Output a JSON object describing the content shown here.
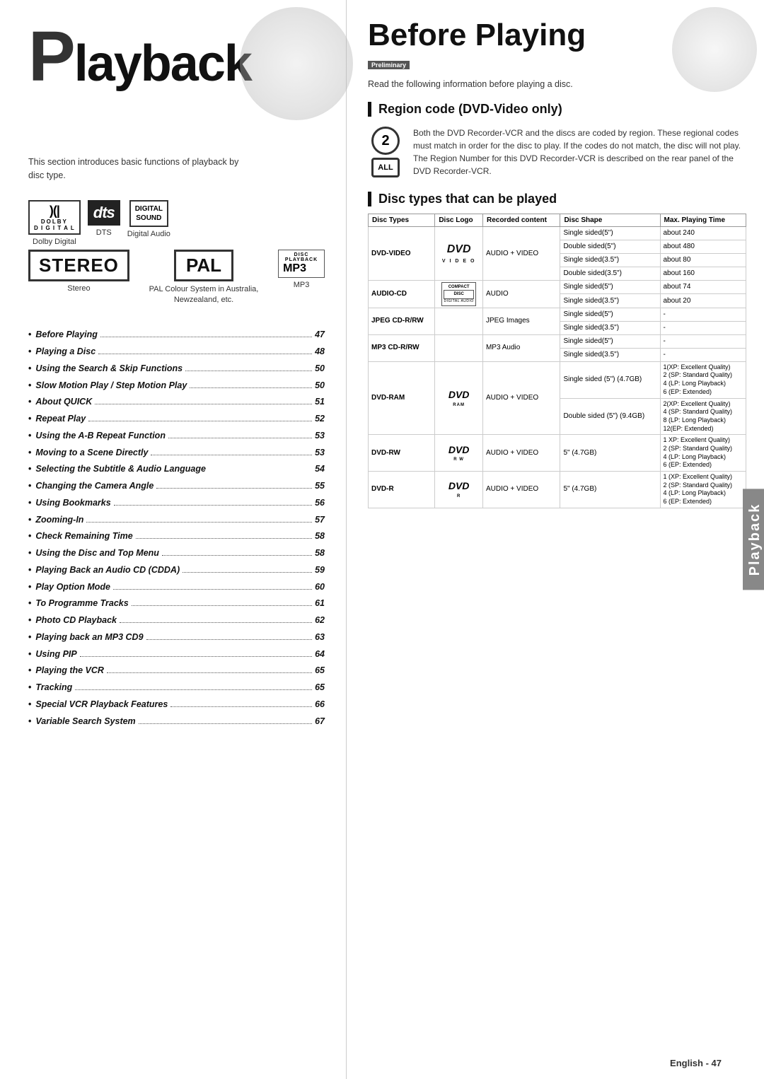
{
  "left": {
    "title_prefix": "P",
    "title_rest": "layback",
    "intro": "This section introduces basic functions of playback by disc type.",
    "logos": {
      "dolby_symbol": ")(|",
      "dolby_label": "DOLBY",
      "dolby_digital": "D I G I T A L",
      "dolby_caption": "Dolby Digital",
      "dts_text": "dts",
      "dts_caption": "DTS",
      "digital_sound_line1": "DIGITAL",
      "digital_sound_line2": "SOUND",
      "digital_caption": "Digital Audio",
      "stereo_text": "STEREO",
      "pal_text": "PAL",
      "pal_caption": "PAL Colour System in Australia, Newzealand, etc.",
      "stereo_caption": "Stereo",
      "mp3_text": "MP3",
      "mp3_caption": "MP3"
    },
    "toc": [
      {
        "label": "Before Playing",
        "dots": true,
        "page": "47"
      },
      {
        "label": "Playing a Disc",
        "dots": true,
        "page": "48"
      },
      {
        "label": "Using the Search & Skip Functions",
        "dots": true,
        "page": "50"
      },
      {
        "label": "Slow Motion Play / Step Motion Play",
        "dots": true,
        "page": "50"
      },
      {
        "label": "About QUICK",
        "dots": true,
        "page": "51"
      },
      {
        "label": "Repeat Play",
        "dots": true,
        "page": "52"
      },
      {
        "label": "Using the A-B Repeat Function",
        "dots": true,
        "page": "53"
      },
      {
        "label": "Moving to a Scene Directly",
        "dots": true,
        "page": "53"
      },
      {
        "label": "Selecting the Subtitle & Audio Language",
        "dots": false,
        "page": "54"
      },
      {
        "label": "Changing the Camera Angle",
        "dots": true,
        "page": "55"
      },
      {
        "label": "Using Bookmarks",
        "dots": true,
        "page": "56"
      },
      {
        "label": "Zooming-In",
        "dots": true,
        "page": "57"
      },
      {
        "label": "Check Remaining Time",
        "dots": true,
        "page": "58"
      },
      {
        "label": "Using the Disc and Top Menu",
        "dots": true,
        "page": "58"
      },
      {
        "label": "Playing Back an Audio CD (CDDA)",
        "dots": true,
        "page": "59"
      },
      {
        "label": "Play Option Mode",
        "dots": true,
        "page": "60"
      },
      {
        "label": "To Programme Tracks",
        "dots": true,
        "page": "61"
      },
      {
        "label": "Photo CD Playback",
        "dots": true,
        "page": "62"
      },
      {
        "label": "Playing back an MP3 CD9",
        "dots": true,
        "page": "63"
      },
      {
        "label": "Using PIP",
        "dots": true,
        "page": "64"
      },
      {
        "label": "Playing the VCR",
        "dots": true,
        "page": "65"
      },
      {
        "label": "Tracking",
        "dots": true,
        "page": "65"
      },
      {
        "label": "Special VCR Playback Features",
        "dots": true,
        "page": "66"
      },
      {
        "label": "Variable Search System",
        "dots": true,
        "page": "67"
      }
    ]
  },
  "right": {
    "title": "Before Playing",
    "preliminary_badge": "Preliminary",
    "read_intro": "Read the following information before playing a disc.",
    "region_title": "Region code (DVD-Video only)",
    "region_num": "2",
    "region_all": "ALL",
    "region_text": "Both the DVD Recorder-VCR and the discs are coded by region. These regional codes must match in order for the disc to play. If the codes do not match, the disc will not play. The Region Number for this DVD Recorder-VCR is described on the rear panel of the DVD Recorder-VCR.",
    "disc_title": "Disc types that can be played",
    "table": {
      "headers": [
        "Disc Types",
        "Disc Logo",
        "Recorded content",
        "Disc Shape",
        "Max. Playing Time"
      ],
      "rows": [
        {
          "type": "DVD-VIDEO",
          "logo": "DVD VIDEO",
          "content": "AUDIO + VIDEO",
          "shapes": [
            {
              "shape": "Single sided(5\")",
              "time": "about 240"
            },
            {
              "shape": "Double sided(5\")",
              "time": "about 480"
            },
            {
              "shape": "Single sided(3.5\")",
              "time": "about 80"
            },
            {
              "shape": "Double sided(3.5\")",
              "time": "about 160"
            }
          ]
        },
        {
          "type": "AUDIO-CD",
          "logo": "COMPACT DISC DIGITAL AUDIO",
          "content": "AUDIO",
          "shapes": [
            {
              "shape": "Single sided(5\")",
              "time": "about 74"
            },
            {
              "shape": "Single sided(3.5\")",
              "time": "about 20"
            }
          ]
        },
        {
          "type": "JPEG CD-R/RW",
          "logo": "",
          "content": "JPEG Images",
          "shapes": [
            {
              "shape": "Single sided(5\")",
              "time": "-"
            },
            {
              "shape": "Single sided(3.5\")",
              "time": "-"
            }
          ]
        },
        {
          "type": "MP3 CD-R/RW",
          "logo": "",
          "content": "MP3 Audio",
          "shapes": [
            {
              "shape": "Single sided(5\")",
              "time": "-"
            },
            {
              "shape": "Single sided(3.5\")",
              "time": "-"
            }
          ]
        },
        {
          "type": "DVD-RAM",
          "logo": "DVD RAM",
          "content": "AUDIO + VIDEO",
          "shapes": [
            {
              "shape": "Single sided (5\") (4.7GB)",
              "time": "1(XP: Excellent Quality)\n2 (SP: Standard Quality)\n4 (LP: Long Playback)\n6 (EP: Extended)"
            },
            {
              "shape": "Double sided (5\") (9.4GB)",
              "time": "2(XP: Excellent Quality)\n4 (SP: Standard Quality)\n8 (LP: Long Playback)\n12(EP: Extended)"
            }
          ]
        },
        {
          "type": "DVD-RW",
          "logo": "DVD RW",
          "content": "AUDIO + VIDEO",
          "shapes": [
            {
              "shape": "5\" (4.7GB)",
              "time": "1 XP: Excellent Quality)\n2 (SP: Standard Quality)\n4 (LP: Long Playback)\n6 (EP: Extended)"
            }
          ]
        },
        {
          "type": "DVD-R",
          "logo": "DVD R",
          "content": "AUDIO + VIDEO",
          "shapes": [
            {
              "shape": "5\" (4.7GB)",
              "time": "1 (XP: Excellent Quality)\n2 (SP: Standard Quality)\n4 (LP: Long Playback)\n6 (EP: Extended)"
            }
          ]
        }
      ]
    },
    "sidebar_label": "Playback",
    "bottom_label": "English - 47"
  }
}
